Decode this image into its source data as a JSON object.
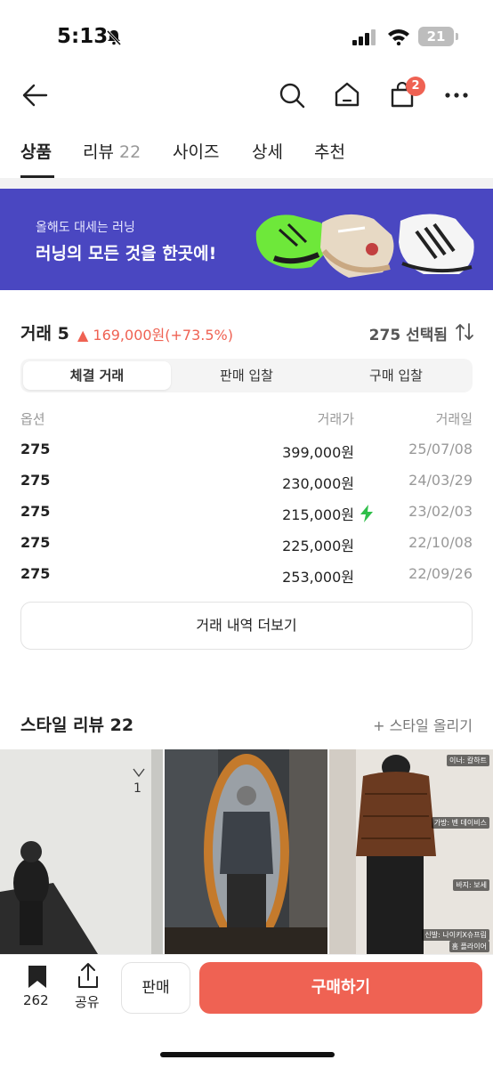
{
  "status_bar": {
    "time": "5:13",
    "battery": "21"
  },
  "header": {
    "cart_badge": "2"
  },
  "tabs": [
    {
      "label": "상품"
    },
    {
      "label": "리뷰",
      "count": "22"
    },
    {
      "label": "사이즈"
    },
    {
      "label": "상세"
    },
    {
      "label": "추천"
    }
  ],
  "banner": {
    "subtitle": "올해도 대세는 러닝",
    "title": "러닝의 모든 것을 한곳에!"
  },
  "trade": {
    "title": "거래 5",
    "change": "▲ 169,000원(+73.5%)",
    "size_selected": "275 선택됨",
    "segments": [
      "체결 거래",
      "판매 입찰",
      "구매 입찰"
    ],
    "columns": [
      "옵션",
      "거래가",
      "거래일"
    ],
    "rows": [
      {
        "option": "275",
        "price": "399,000원",
        "date": "25/07/08",
        "fast": false
      },
      {
        "option": "275",
        "price": "230,000원",
        "date": "24/03/29",
        "fast": false
      },
      {
        "option": "275",
        "price": "215,000원",
        "date": "23/02/03",
        "fast": true
      },
      {
        "option": "275",
        "price": "225,000원",
        "date": "22/10/08",
        "fast": false
      },
      {
        "option": "275",
        "price": "253,000원",
        "date": "22/09/26",
        "fast": false
      }
    ],
    "more_label": "거래 내역 더보기"
  },
  "style_review": {
    "title": "스타일 리뷰 22",
    "upload_label": "+ 스타일 올리기",
    "photo3_tags": [
      "이너: 칼하트",
      "가방: 벤 데이비스",
      "바지: 보세",
      "신발: 나이키X슈프림",
      "홈 플라이어"
    ]
  },
  "bottom_bar": {
    "bookmark_count": "262",
    "share_label": "공유",
    "sell_label": "판매",
    "buy_label": "구매하기"
  },
  "colors": {
    "accent": "#ef6253",
    "banner_bg": "#4a47c1",
    "fast_icon": "#2fbf4a"
  }
}
